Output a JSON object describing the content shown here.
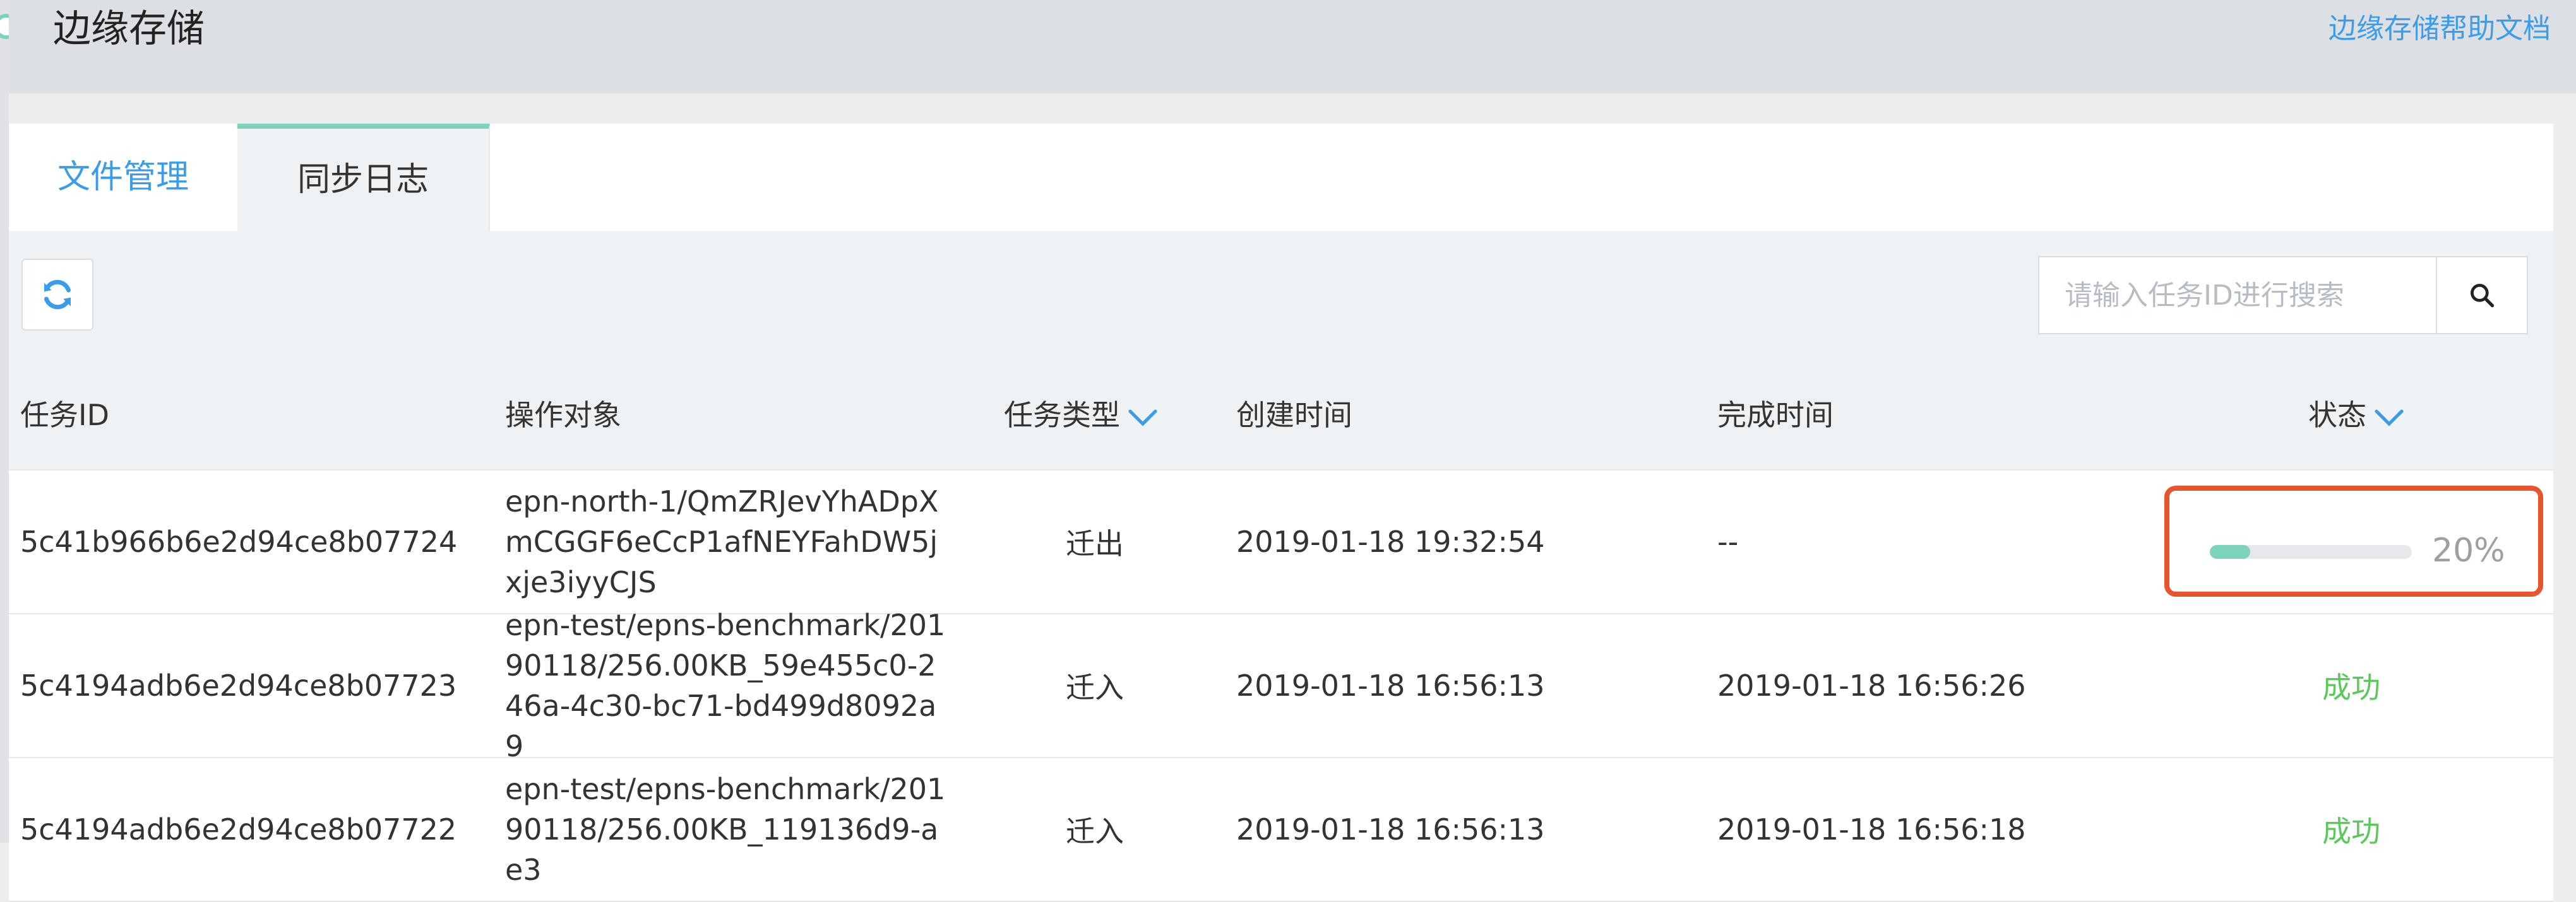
{
  "header": {
    "title": "边缘存储",
    "help_link": "边缘存储帮助文档"
  },
  "tabs": [
    {
      "label": "文件管理",
      "active": false
    },
    {
      "label": "同步日志",
      "active": true
    }
  ],
  "toolbar": {
    "refresh_icon": "refresh-icon",
    "search_placeholder": "请输入任务ID进行搜索",
    "search_value": "",
    "search_icon": "search-icon"
  },
  "table": {
    "columns": {
      "task_id": "任务ID",
      "object": "操作对象",
      "task_type": "任务类型",
      "created": "创建时间",
      "finished": "完成时间",
      "status": "状态"
    },
    "rows": [
      {
        "task_id": "5c41b966b6e2d94ce8b07724",
        "object": "epn-north-1/QmZRJevYhADpXmCGGF6eCcP1afNEYFahDW5jxje3iyyCJS",
        "task_type": "迁出",
        "created": "2019-01-18 19:32:54",
        "finished": "--",
        "progress_percent": 20,
        "progress_label": "20%"
      },
      {
        "task_id": "5c4194adb6e2d94ce8b07723",
        "object": "epn-test/epns-benchmark/20190118/256.00KB_59e455c0-246a-4c30-bc71-bd499d8092a9",
        "task_type": "迁入",
        "created": "2019-01-18 16:56:13",
        "finished": "2019-01-18 16:56:26",
        "status": "成功"
      },
      {
        "task_id": "5c4194adb6e2d94ce8b07722",
        "object": "epn-test/epns-benchmark/20190118/256.00KB_119136d9-ae3",
        "task_type": "迁入",
        "created": "2019-01-18 16:56:13",
        "finished": "2019-01-18 16:56:18",
        "status": "成功"
      }
    ]
  },
  "colors": {
    "accent": "#3b9de8",
    "active_tab_border": "#7bd3ba",
    "success": "#5cc85c",
    "highlight_box": "#e8542d"
  }
}
